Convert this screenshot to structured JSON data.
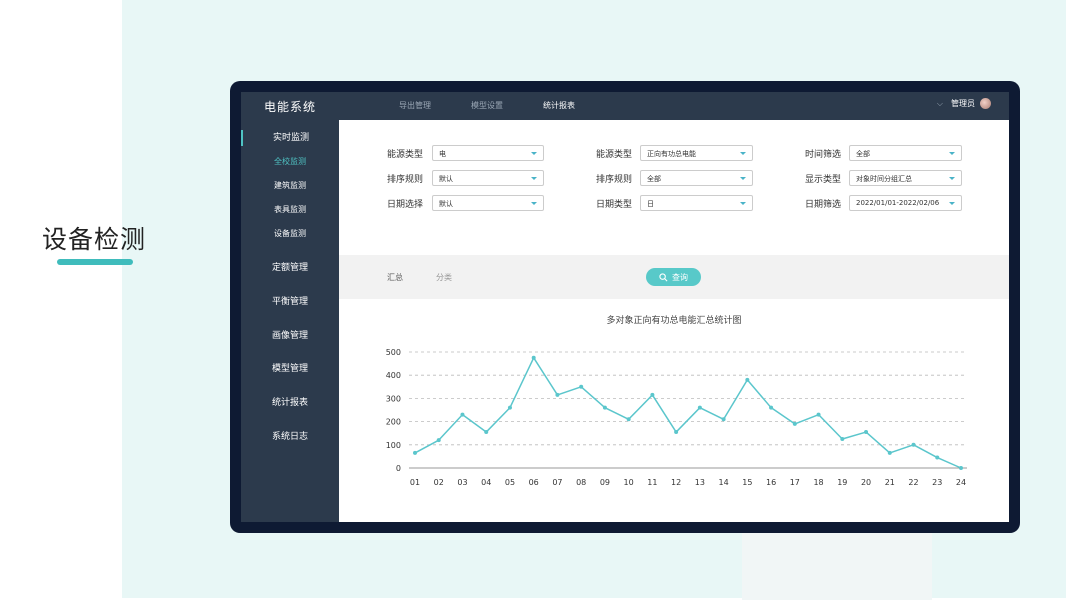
{
  "slide": {
    "heading": "设备检测"
  },
  "topbar": {
    "brand": "电能系统",
    "nav": [
      {
        "label": "导出管理",
        "active": false
      },
      {
        "label": "模型设置",
        "active": false
      },
      {
        "label": "统计报表",
        "active": true
      }
    ],
    "user_name": "管理员"
  },
  "sidebar": {
    "items": [
      {
        "label": "实时监测",
        "selected": true
      },
      {
        "label": "全校监测",
        "sub": true,
        "selected": true
      },
      {
        "label": "建筑监测",
        "sub": true
      },
      {
        "label": "表具监测",
        "sub": true
      },
      {
        "label": "设备监测",
        "sub": true
      },
      {
        "label": "定额管理"
      },
      {
        "label": "平衡管理"
      },
      {
        "label": "画像管理"
      },
      {
        "label": "模型管理"
      },
      {
        "label": "统计报表"
      },
      {
        "label": "系统日志"
      }
    ]
  },
  "filters": [
    {
      "label": "能源类型",
      "value": "电"
    },
    {
      "label": "能源类型",
      "value": "正向有功总电能"
    },
    {
      "label": "时间筛选",
      "value": "全部"
    },
    {
      "label": "排序规则",
      "value": "默认"
    },
    {
      "label": "排序规则",
      "value": "全部"
    },
    {
      "label": "显示类型",
      "value": "对象时间分组汇总"
    },
    {
      "label": "日期选择",
      "value": "默认"
    },
    {
      "label": "日期类型",
      "value": "日"
    },
    {
      "label": "日期筛选",
      "value": "2022/01/01-2022/02/06"
    }
  ],
  "tabs": {
    "summary": "汇总",
    "category": "分类"
  },
  "query_button": "查询",
  "colors": {
    "accent": "#4fc3c3",
    "line": "#5bc6cc",
    "nav_bg": "#2c3a4c"
  },
  "chart_data": {
    "type": "line",
    "title": "多对象正向有功总电能汇总统计图",
    "categories": [
      "01",
      "02",
      "03",
      "04",
      "05",
      "06",
      "07",
      "08",
      "09",
      "10",
      "11",
      "12",
      "13",
      "14",
      "15",
      "16",
      "17",
      "18",
      "19",
      "20",
      "21",
      "22",
      "23",
      "24"
    ],
    "series": [
      {
        "values": [
          65,
          120,
          230,
          155,
          260,
          475,
          315,
          350,
          260,
          210,
          315,
          155,
          260,
          210,
          380,
          260,
          190,
          230,
          125,
          155,
          65,
          100,
          45,
          0
        ]
      }
    ],
    "ylim": [
      0,
      500
    ],
    "yticks": [
      0,
      100,
      200,
      300,
      400,
      500
    ],
    "grid": true
  }
}
